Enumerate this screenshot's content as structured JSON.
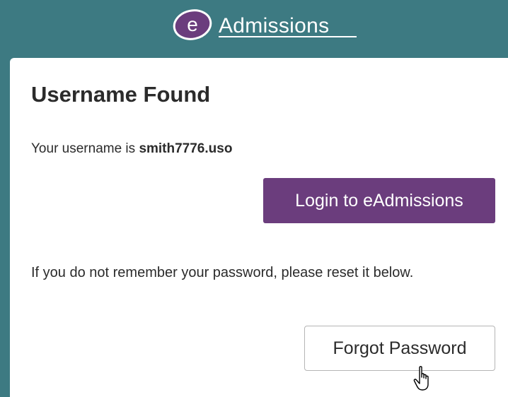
{
  "header": {
    "logo_letter": "e",
    "logo_text": "Admissions"
  },
  "card": {
    "title": "Username Found",
    "username_prefix": "Your username is ",
    "username": "smith7776.uso",
    "login_button": "Login to eAdmissions",
    "reset_text": "If you do not remember your password, please reset it below.",
    "forgot_button": "Forgot Password"
  },
  "colors": {
    "background": "#3d7a82",
    "accent": "#6b3d7d",
    "card": "#ffffff"
  },
  "icons": {
    "cursor": "hand-pointer-icon"
  }
}
